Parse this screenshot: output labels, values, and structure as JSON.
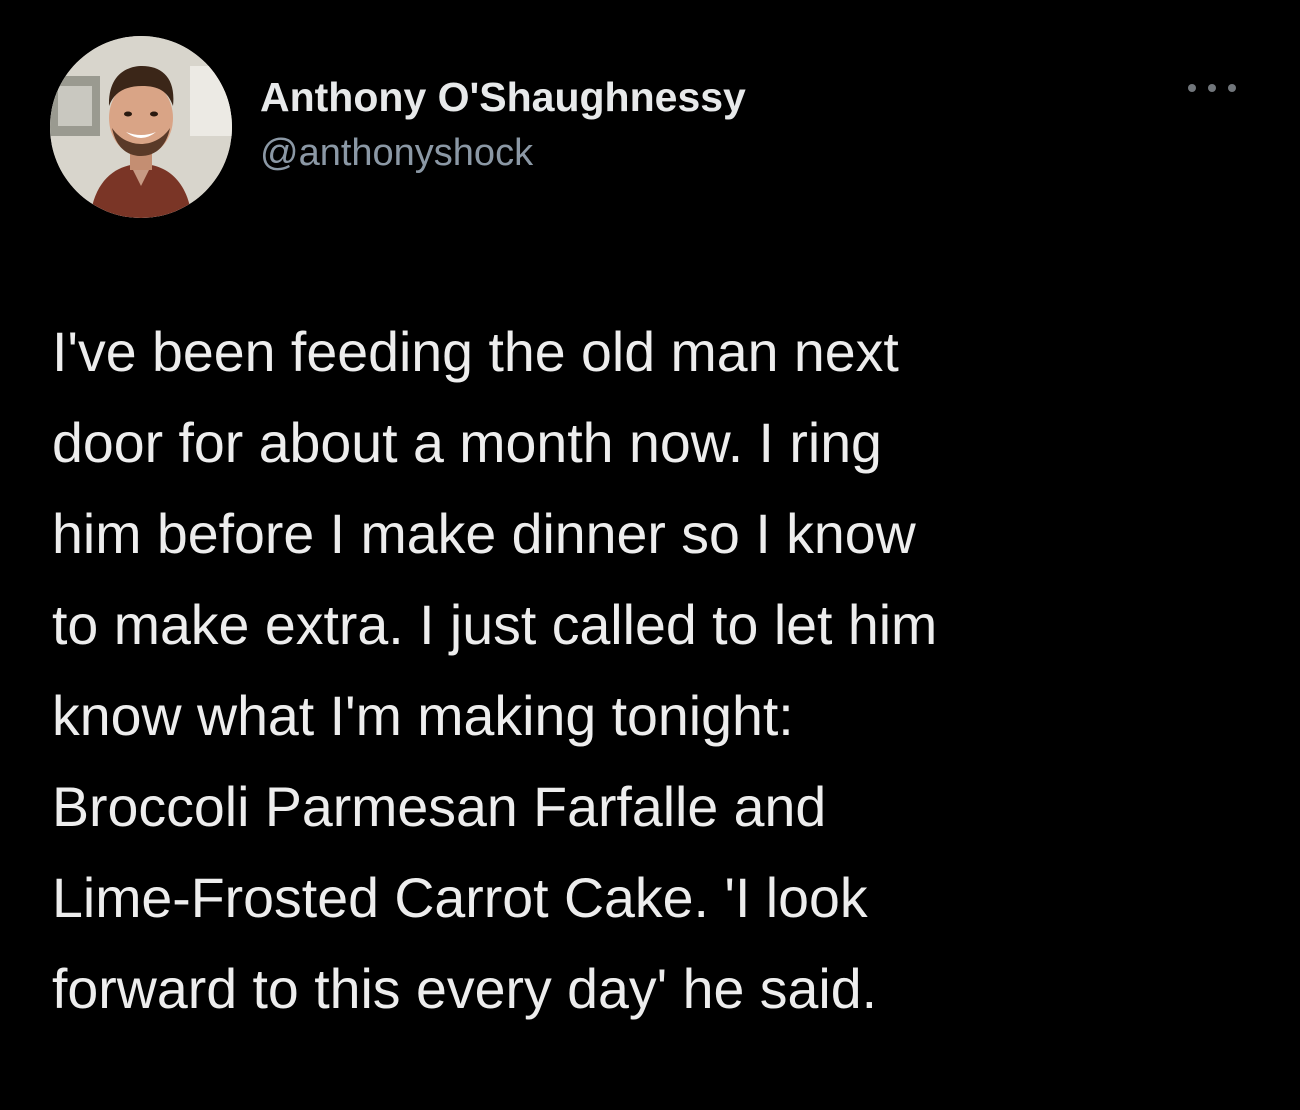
{
  "author": {
    "display_name": "Anthony O'Shaughnessy",
    "handle": "@anthonyshock",
    "avatar_icon": "profile-photo-icon"
  },
  "menu": {
    "more_icon": "more-options-icon"
  },
  "tweet": {
    "lines": [
      "I've been feeding the old man next",
      "door for about a month now. I ring",
      "him before I make dinner so I know",
      "to make extra. I just called to let him",
      "know what I'm making tonight:",
      "Broccoli Parmesan Farfalle and",
      "Lime-Frosted Carrot Cake. 'I look",
      "forward to this every day' he said."
    ]
  },
  "colors": {
    "background": "#000000",
    "text_primary": "#e7e9ea",
    "text_secondary": "#8b98a5"
  }
}
